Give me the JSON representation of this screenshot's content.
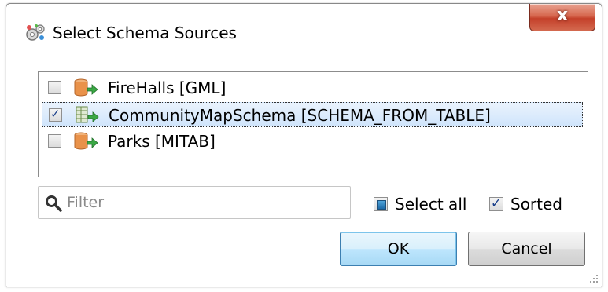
{
  "dialog": {
    "title": "Select Schema Sources",
    "close_label": "x"
  },
  "sources": [
    {
      "label": "FireHalls [GML]",
      "checked": false,
      "selected": false,
      "icon": "database-arrow-icon"
    },
    {
      "label": "CommunityMapSchema [SCHEMA_FROM_TABLE]",
      "checked": true,
      "selected": true,
      "icon": "schema-table-icon"
    },
    {
      "label": "Parks [MITAB]",
      "checked": false,
      "selected": false,
      "icon": "database-arrow-icon"
    }
  ],
  "filter": {
    "placeholder": "Filter",
    "value": ""
  },
  "options": {
    "select_all_label": "Select all",
    "select_all_state": "partial",
    "sorted_label": "Sorted",
    "sorted_checked": true
  },
  "buttons": {
    "ok_label": "OK",
    "cancel_label": "Cancel"
  },
  "colors": {
    "close_button": "#c4402a",
    "selection": "#cfe4fb",
    "default_button": "#bee6fd"
  }
}
